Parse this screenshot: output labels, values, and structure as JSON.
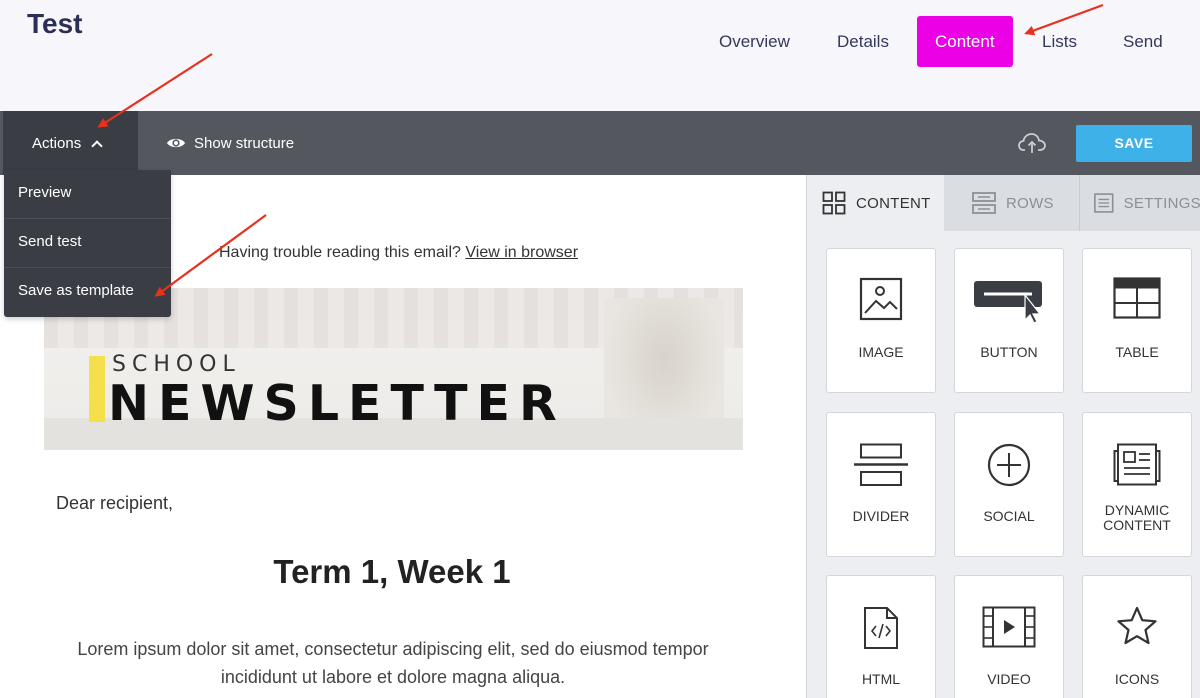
{
  "header": {
    "title": "Test",
    "nav": [
      {
        "label": "Overview",
        "active": false
      },
      {
        "label": "Details",
        "active": false
      },
      {
        "label": "Content",
        "active": true
      },
      {
        "label": "Lists",
        "active": false
      },
      {
        "label": "Send",
        "active": false
      }
    ]
  },
  "toolbar": {
    "actions_label": "Actions",
    "show_structure_label": "Show structure",
    "save_label": "SAVE"
  },
  "actions_menu": {
    "items": [
      "Preview",
      "Send test",
      "Save as template"
    ]
  },
  "email": {
    "trouble_text": "Having trouble reading this email?",
    "view_link": "View in browser",
    "banner_line1": "SCHOOL",
    "banner_line2": "NEWSLETTER",
    "greeting": "Dear recipient,",
    "heading": "Term 1, Week 1",
    "body": "Lorem ipsum dolor sit amet, consectetur adipiscing elit, sed do eiusmod tempor incididunt ut labore et dolore magna aliqua."
  },
  "sidebar": {
    "tabs": [
      {
        "label": "CONTENT",
        "icon": "grid-icon",
        "active": true
      },
      {
        "label": "ROWS",
        "icon": "rows-icon",
        "active": false
      },
      {
        "label": "SETTINGS",
        "icon": "settings-icon",
        "active": false
      }
    ],
    "tiles": [
      {
        "label": "IMAGE",
        "icon": "image-icon"
      },
      {
        "label": "BUTTON",
        "icon": "button-icon"
      },
      {
        "label": "TABLE",
        "icon": "table-icon"
      },
      {
        "label": "DIVIDER",
        "icon": "divider-icon"
      },
      {
        "label": "SOCIAL",
        "icon": "plus-circle-icon"
      },
      {
        "label": "DYNAMIC CONTENT",
        "label_line1": "DYNAMIC",
        "label_line2": "CONTENT",
        "icon": "dynamic-content-icon"
      },
      {
        "label": "HTML",
        "icon": "html-file-icon"
      },
      {
        "label": "VIDEO",
        "icon": "video-icon"
      },
      {
        "label": "ICONS",
        "icon": "star-icon"
      }
    ]
  },
  "colors": {
    "accent_magenta": "#ec00e6",
    "save_blue": "#3fb1e9",
    "toolbar_gray": "#54585e",
    "menu_dark": "#3a3e44",
    "annotation_red": "#e8301c"
  }
}
